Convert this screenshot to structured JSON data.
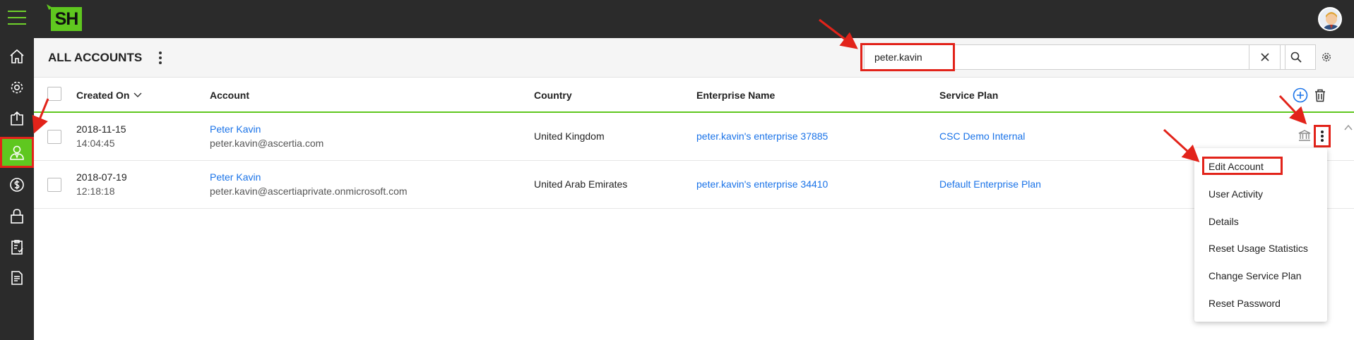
{
  "app": {
    "logo_text": "SH"
  },
  "header": {
    "title": "ALL ACCOUNTS"
  },
  "search": {
    "value": "peter.kavin",
    "placeholder": ""
  },
  "table": {
    "columns": [
      "Created On",
      "Account",
      "Country",
      "Enterprise Name",
      "Service Plan"
    ],
    "rows": [
      {
        "date": "2018-11-15",
        "time": "14:04:45",
        "name": "Peter Kavin",
        "email": "peter.kavin@ascertia.com",
        "country": "United Kingdom",
        "enterprise": "peter.kavin's enterprise 37885",
        "plan": "CSC Demo Internal"
      },
      {
        "date": "2018-07-19",
        "time": "12:18:18",
        "name": "Peter Kavin",
        "email": "peter.kavin@ascertiaprivate.onmicrosoft.com",
        "country": "United Arab Emirates",
        "enterprise": "peter.kavin's enterprise 34410",
        "plan": "Default Enterprise Plan"
      }
    ]
  },
  "context_menu": {
    "items": [
      "Edit Account",
      "User Activity",
      "Details",
      "Reset Usage Statistics",
      "Change Service Plan",
      "Reset Password"
    ]
  },
  "colors": {
    "accent": "#5fc71f",
    "link": "#1a73e8",
    "highlight": "#e2231a",
    "dark": "#2b2b2b"
  }
}
